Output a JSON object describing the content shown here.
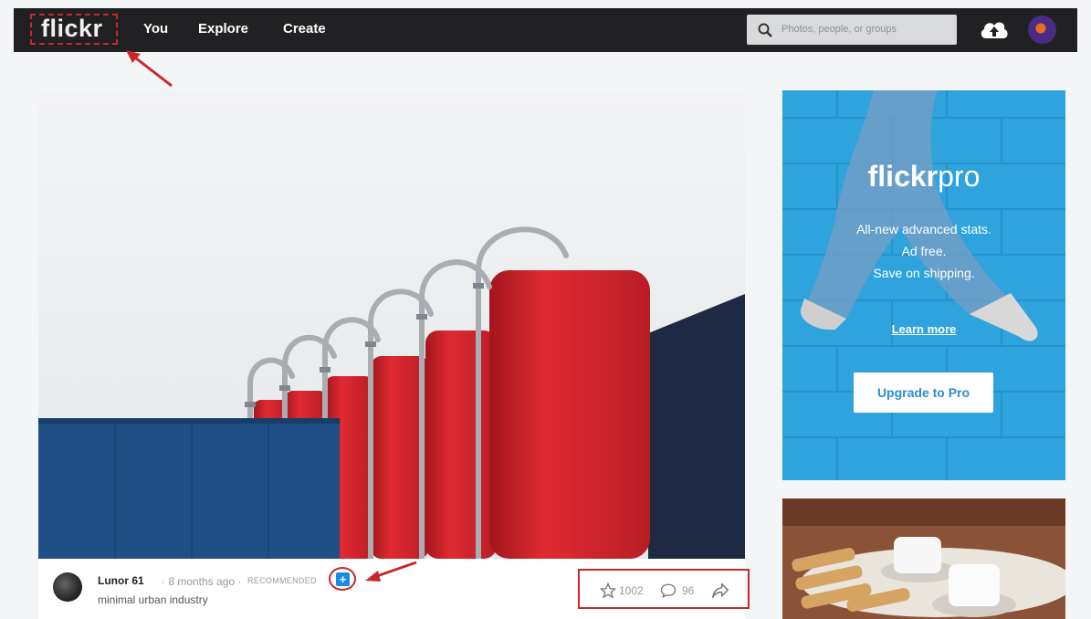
{
  "header": {
    "logo": "flickr",
    "nav": [
      "You",
      "Explore",
      "Create"
    ],
    "search_placeholder": "Photos, people, or groups"
  },
  "photo": {
    "owner": "Lunor 61",
    "time": "· 8 months ago ·",
    "badge": "RECOMMENDED",
    "plus": "+",
    "description": "minimal urban industry",
    "faves": "1002",
    "comments": "96"
  },
  "ad": {
    "brand_bold": "flickr",
    "brand_light": "pro",
    "lines": [
      "All-new advanced stats.",
      "Ad free.",
      "Save on shipping."
    ],
    "learn_more": "Learn more",
    "upgrade": "Upgrade to Pro"
  },
  "colors": {
    "topbar": "#212124",
    "annotation": "#c8282b",
    "ad_blue": "#2ea3dd",
    "silo_red": "#d8262f"
  }
}
